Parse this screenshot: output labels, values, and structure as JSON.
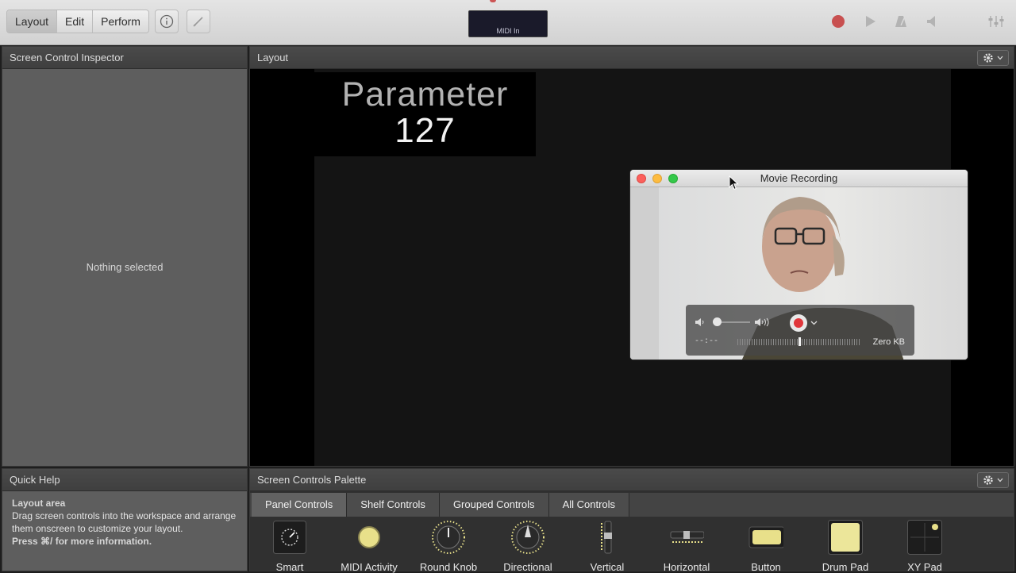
{
  "toolbar": {
    "modes": [
      "Layout",
      "Edit",
      "Perform"
    ],
    "active_mode": "Layout",
    "midi_in_label": "MIDI In"
  },
  "inspector": {
    "title": "Screen Control Inspector",
    "empty_text": "Nothing selected"
  },
  "layout": {
    "title": "Layout",
    "parameter_name": "Parameter",
    "parameter_value": "127"
  },
  "quick_help": {
    "title": "Quick Help",
    "heading": "Layout area",
    "body": "Drag screen controls into the workspace and arrange them onscreen to customize your layout.",
    "hint": "Press ⌘/ for more information."
  },
  "palette": {
    "title": "Screen Controls Palette",
    "tabs": [
      "Panel Controls",
      "Shelf Controls",
      "Grouped Controls",
      "All Controls"
    ],
    "active_tab": "Panel Controls",
    "controls": [
      "Smart",
      "MIDI Activity",
      "Round Knob",
      "Directional",
      "Vertical",
      "Horizontal",
      "Button",
      "Drum Pad",
      "XY Pad"
    ]
  },
  "movie_recording": {
    "title": "Movie Recording",
    "time": "--:--",
    "file_size": "Zero KB"
  },
  "colors": {
    "accent_yellow": "#e8e08a",
    "record_red": "#e0363b",
    "panel_bg": "#5e5e5e"
  }
}
